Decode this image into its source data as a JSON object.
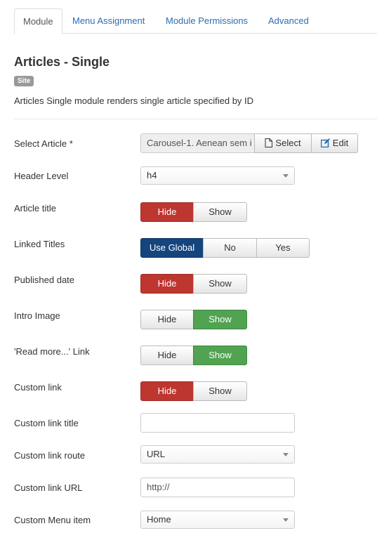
{
  "tabs": [
    {
      "label": "Module"
    },
    {
      "label": "Menu Assignment"
    },
    {
      "label": "Module Permissions"
    },
    {
      "label": "Advanced"
    }
  ],
  "module": {
    "title": "Articles - Single",
    "badge": "Site",
    "description": "Articles Single module renders single article specified by ID"
  },
  "fields": {
    "select_article": {
      "label": "Select Article *",
      "value": "Carousel-1. Aenean sem i",
      "select_label": "Select",
      "edit_label": "Edit"
    },
    "header_level": {
      "label": "Header Level",
      "value": "h4"
    },
    "article_title": {
      "label": "Article title",
      "options": [
        "Hide",
        "Show"
      ],
      "selected": "Hide"
    },
    "linked_titles": {
      "label": "Linked Titles",
      "options": [
        "Use Global",
        "No",
        "Yes"
      ],
      "selected": "Use Global"
    },
    "published_date": {
      "label": "Published date",
      "options": [
        "Hide",
        "Show"
      ],
      "selected": "Hide"
    },
    "intro_image": {
      "label": "Intro Image",
      "options": [
        "Hide",
        "Show"
      ],
      "selected": "Show"
    },
    "read_more": {
      "label": "'Read more...' Link",
      "options": [
        "Hide",
        "Show"
      ],
      "selected": "Show"
    },
    "custom_link": {
      "label": "Custom link",
      "options": [
        "Hide",
        "Show"
      ],
      "selected": "Hide"
    },
    "custom_link_title": {
      "label": "Custom link title",
      "value": ""
    },
    "custom_link_route": {
      "label": "Custom link route",
      "value": "URL"
    },
    "custom_link_url": {
      "label": "Custom link URL",
      "value": "http://"
    },
    "custom_menu_item": {
      "label": "Custom Menu item",
      "value": "Home"
    }
  },
  "colors": {
    "hide_active": "#bd362f",
    "show_active": "#51a351",
    "global_active": "#14457d",
    "link": "#2a6db3"
  }
}
